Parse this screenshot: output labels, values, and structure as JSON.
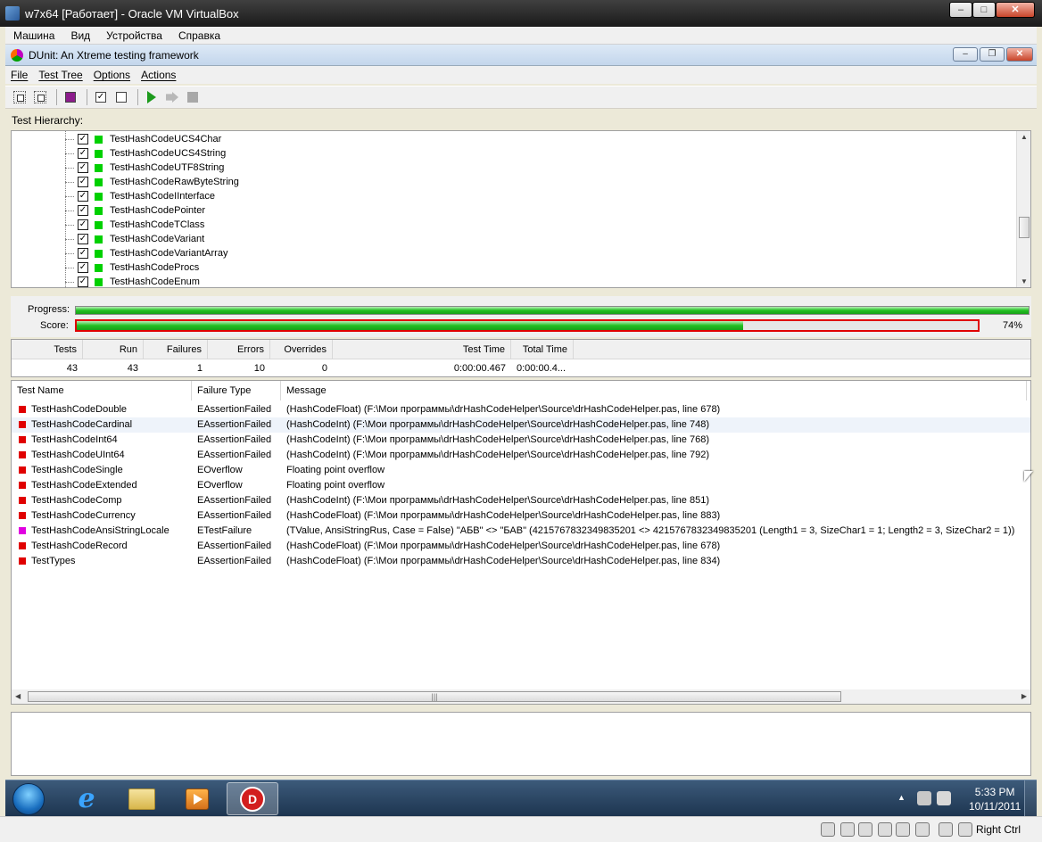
{
  "vbox": {
    "title": "w7x64 [Работает] - Oracle VM VirtualBox",
    "menu": [
      "Машина",
      "Вид",
      "Устройства",
      "Справка"
    ],
    "host_key": "Right Ctrl"
  },
  "dunit": {
    "title": "DUnit: An Xtreme testing framework",
    "menu": [
      "File",
      "Test Tree",
      "Options",
      "Actions"
    ],
    "hierarchy_label": "Test Hierarchy:",
    "tree_items": [
      "TestHashCodeUCS4Char",
      "TestHashCodeUCS4String",
      "TestHashCodeUTF8String",
      "TestHashCodeRawByteString",
      "TestHashCodeIInterface",
      "TestHashCodePointer",
      "TestHashCodeTClass",
      "TestHashCodeVariant",
      "TestHashCodeVariantArray",
      "TestHashCodeProcs",
      "TestHashCodeEnum"
    ],
    "progress": {
      "progress_label": "Progress:",
      "score_label": "Score:",
      "progress_value": 1.0,
      "score_value": 0.74,
      "score_text": "74%"
    },
    "stats": {
      "headers": [
        "Tests",
        "Run",
        "Failures",
        "Errors",
        "Overrides",
        "Test Time",
        "Total Time"
      ],
      "values": [
        "43",
        "43",
        "1",
        "10",
        "0",
        "0:00:00.467",
        "0:00:00.4..."
      ]
    },
    "failures": {
      "headers": [
        "Test Name",
        "Failure Type",
        "Message"
      ],
      "rows": [
        {
          "name": "TestHashCodeDouble",
          "type": "EAssertionFailed",
          "message": "(HashCodeFloat) (F:\\Мои программы\\drHashCodeHelper\\Source\\drHashCodeHelper.pas, line 678)",
          "color": "#e00000"
        },
        {
          "name": "TestHashCodeCardinal",
          "type": "EAssertionFailed",
          "message": "(HashCodeInt) (F:\\Мои программы\\drHashCodeHelper\\Source\\drHashCodeHelper.pas, line 748)",
          "color": "#e00000"
        },
        {
          "name": "TestHashCodeInt64",
          "type": "EAssertionFailed",
          "message": "(HashCodeInt) (F:\\Мои программы\\drHashCodeHelper\\Source\\drHashCodeHelper.pas, line 768)",
          "color": "#e00000"
        },
        {
          "name": "TestHashCodeUInt64",
          "type": "EAssertionFailed",
          "message": "(HashCodeInt) (F:\\Мои программы\\drHashCodeHelper\\Source\\drHashCodeHelper.pas, line 792)",
          "color": "#e00000"
        },
        {
          "name": "TestHashCodeSingle",
          "type": "EOverflow",
          "message": "Floating point overflow",
          "color": "#e00000"
        },
        {
          "name": "TestHashCodeExtended",
          "type": "EOverflow",
          "message": "Floating point overflow",
          "color": "#e00000"
        },
        {
          "name": "TestHashCodeComp",
          "type": "EAssertionFailed",
          "message": "(HashCodeInt) (F:\\Мои программы\\drHashCodeHelper\\Source\\drHashCodeHelper.pas, line 851)",
          "color": "#e00000"
        },
        {
          "name": "TestHashCodeCurrency",
          "type": "EAssertionFailed",
          "message": "(HashCodeFloat) (F:\\Мои программы\\drHashCodeHelper\\Source\\drHashCodeHelper.pas, line 883)",
          "color": "#e00000"
        },
        {
          "name": "TestHashCodeAnsiStringLocale",
          "type": "ETestFailure",
          "message": "(TValue, AnsiStringRus, Case = False) \"АБВ\" <> \"БАВ\" (4215767832349835201 <> 4215767832349835201 (Length1 = 3, SizeChar1 = 1; Length2 = 3, SizeChar2 = 1))",
          "color": "#e000e0"
        },
        {
          "name": "TestHashCodeRecord",
          "type": "EAssertionFailed",
          "message": "(HashCodeFloat) (F:\\Мои программы\\drHashCodeHelper\\Source\\drHashCodeHelper.pas, line 678)",
          "color": "#e00000"
        },
        {
          "name": "TestTypes",
          "type": "EAssertionFailed",
          "message": "(HashCodeFloat) (F:\\Мои программы\\drHashCodeHelper\\Source\\drHashCodeHelper.pas, line 834)",
          "color": "#e00000"
        }
      ]
    }
  },
  "taskbar": {
    "time": "5:33 PM",
    "date": "10/11/2011",
    "dunit_app_letter": "D"
  }
}
